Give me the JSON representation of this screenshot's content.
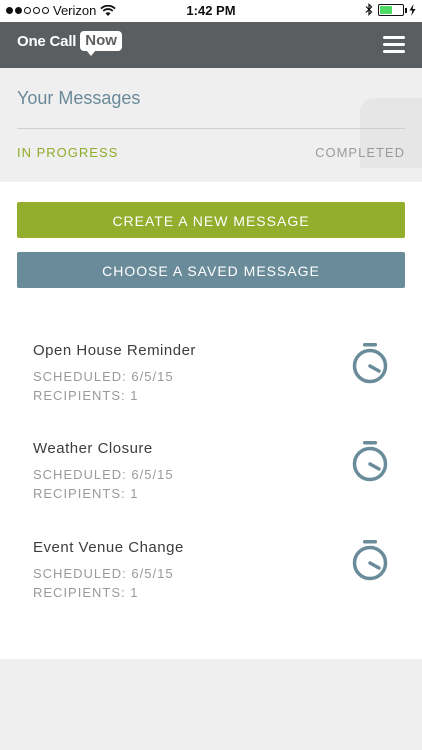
{
  "status_bar": {
    "carrier": "Verizon",
    "time": "1:42 PM",
    "signal_filled": 2,
    "signal_total": 5,
    "battery_level": 0.55,
    "battery_color": "#4cd964"
  },
  "header": {
    "logo_text_one": "One Call",
    "logo_text_now": "Now",
    "menu_icon": "hamburger-menu-icon"
  },
  "messages": {
    "title": "Your Messages",
    "tabs": [
      {
        "label": "IN PROGRESS",
        "active": true
      },
      {
        "label": "COMPLETED",
        "active": false
      }
    ]
  },
  "actions": {
    "create_label": "CREATE A NEW MESSAGE",
    "choose_label": "CHOOSE A SAVED MESSAGE"
  },
  "message_list": [
    {
      "title": "Open House Reminder",
      "scheduled": "SCHEDULED: 6/5/15",
      "recipients": "RECIPIENTS: 1",
      "icon": "stopwatch-icon"
    },
    {
      "title": "Weather Closure",
      "scheduled": "SCHEDULED: 6/5/15",
      "recipients": "RECIPIENTS: 1",
      "icon": "stopwatch-icon"
    },
    {
      "title": "Event Venue Change",
      "scheduled": "SCHEDULED: 6/5/15",
      "recipients": "RECIPIENTS: 1",
      "icon": "stopwatch-icon"
    }
  ],
  "colors": {
    "accent_green": "#93ad2c",
    "accent_blue": "#6a8c9a",
    "header_gray": "#5a5e61"
  }
}
